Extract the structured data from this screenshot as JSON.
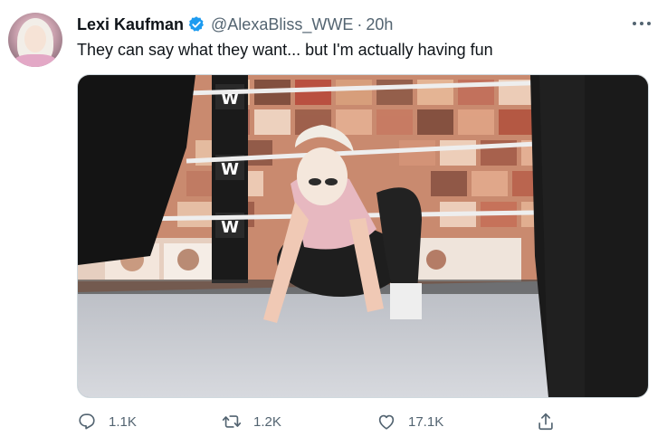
{
  "tweet": {
    "display_name": "Lexi Kaufman",
    "handle": "@AlexaBliss_WWE",
    "separator": "·",
    "time": "20h",
    "text": "They can say what they want... but I'm actually having fun",
    "more_icon": "more-dots-icon",
    "verified_icon": "verified-badge-icon"
  },
  "media": {
    "brand_marks": [
      "W",
      "W",
      "W"
    ]
  },
  "actions": {
    "reply": {
      "icon": "reply-icon",
      "count": "1.1K"
    },
    "retweet": {
      "icon": "retweet-icon",
      "count": "1.2K"
    },
    "like": {
      "icon": "heart-icon",
      "count": "17.1K"
    },
    "share": {
      "icon": "share-icon"
    }
  },
  "colors": {
    "verified_blue": "#1d9bf0",
    "secondary_text": "#536471",
    "primary_text": "#0f1419"
  }
}
